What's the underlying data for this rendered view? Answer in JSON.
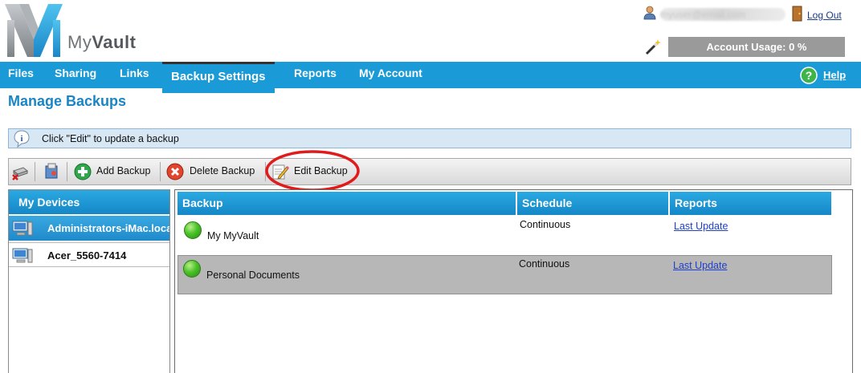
{
  "brand": {
    "name_light": "My",
    "name_bold": "Vault"
  },
  "header": {
    "user_email": "myuser@email.com",
    "logout_label": "Log Out",
    "account_usage": "Account Usage: 0 %"
  },
  "nav": {
    "items": [
      "Files",
      "Sharing",
      "Links",
      "Backup Settings",
      "Reports",
      "My Account"
    ],
    "active": "Backup Settings",
    "help_label": "Help"
  },
  "page": {
    "title": "Manage Backups",
    "info_text": "Click \"Edit\" to update a backup"
  },
  "toolbar": {
    "add_label": "Add Backup",
    "delete_label": "Delete Backup",
    "edit_label": "Edit Backup"
  },
  "devices": {
    "header": "My Devices",
    "items": [
      "Administrators-iMac.local",
      "Acer_5560-7414"
    ],
    "selected_index": 0
  },
  "backups": {
    "columns": [
      "Backup",
      "Schedule",
      "Reports"
    ],
    "rows": [
      {
        "name": "My MyVault",
        "schedule": "Continuous",
        "report": "Last Update",
        "status": "green"
      },
      {
        "name": "Personal Documents",
        "schedule": "Continuous",
        "report": "Last Update",
        "status": "green"
      }
    ]
  },
  "colors": {
    "nav_bg": "#1a9bd7",
    "title": "#1a85c4",
    "highlight": "#e01b1b",
    "status_ok": "#4cc22a"
  }
}
